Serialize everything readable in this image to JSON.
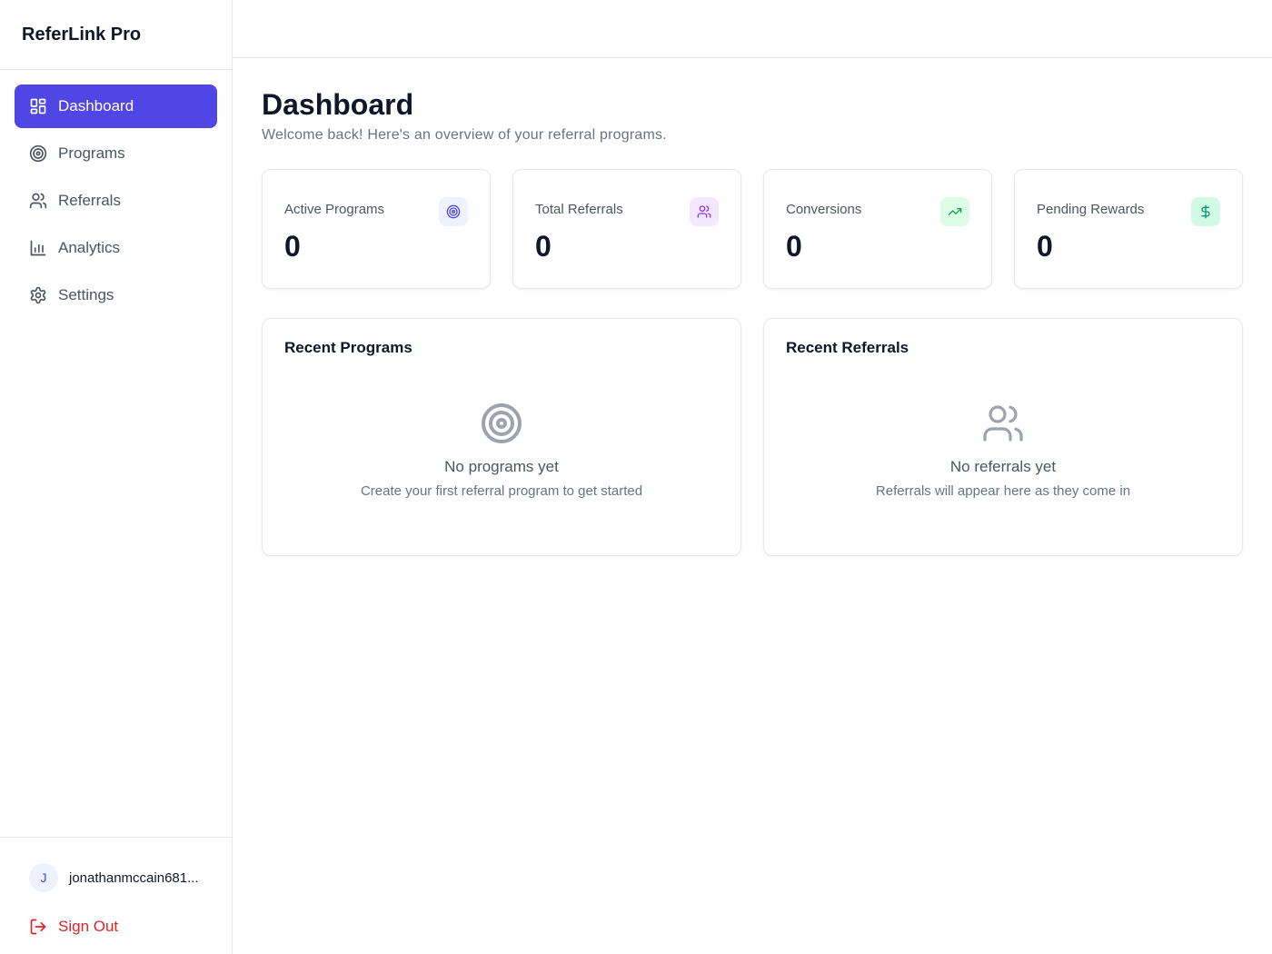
{
  "app": {
    "brand": "ReferLink Pro"
  },
  "sidebar": {
    "items": [
      {
        "label": "Dashboard",
        "icon": "dashboard-icon",
        "active": true
      },
      {
        "label": "Programs",
        "icon": "target-icon"
      },
      {
        "label": "Referrals",
        "icon": "users-icon"
      },
      {
        "label": "Analytics",
        "icon": "bar-chart-icon"
      },
      {
        "label": "Settings",
        "icon": "gear-icon"
      }
    ],
    "user": {
      "initial": "J",
      "name": "jonathanmccain681..."
    },
    "sign_out": "Sign Out"
  },
  "header": {
    "title": "Dashboard",
    "subtitle": "Welcome back! Here's an overview of your referral programs."
  },
  "stats": [
    {
      "label": "Active Programs",
      "value": "0",
      "icon": "target-icon",
      "icon_bg": "#eef2ff",
      "icon_color": "#4f46e5"
    },
    {
      "label": "Total Referrals",
      "value": "0",
      "icon": "users-icon",
      "icon_bg": "#f3e8ff",
      "icon_color": "#9333ea"
    },
    {
      "label": "Conversions",
      "value": "0",
      "icon": "trending-up-icon",
      "icon_bg": "#dcfce7",
      "icon_color": "#16a34a"
    },
    {
      "label": "Pending Rewards",
      "value": "0",
      "icon": "dollar-icon",
      "icon_bg": "#d1fae5",
      "icon_color": "#059669"
    }
  ],
  "panels": {
    "recent_programs": {
      "title": "Recent Programs",
      "empty_title": "No programs yet",
      "empty_desc": "Create your first referral program to get started",
      "icon": "target-icon"
    },
    "recent_referrals": {
      "title": "Recent Referrals",
      "empty_title": "No referrals yet",
      "empty_desc": "Referrals will appear here as they come in",
      "icon": "users-icon"
    }
  },
  "colors": {
    "accent": "#4f46e5",
    "danger": "#dc2626",
    "border": "#e5e7eb"
  }
}
